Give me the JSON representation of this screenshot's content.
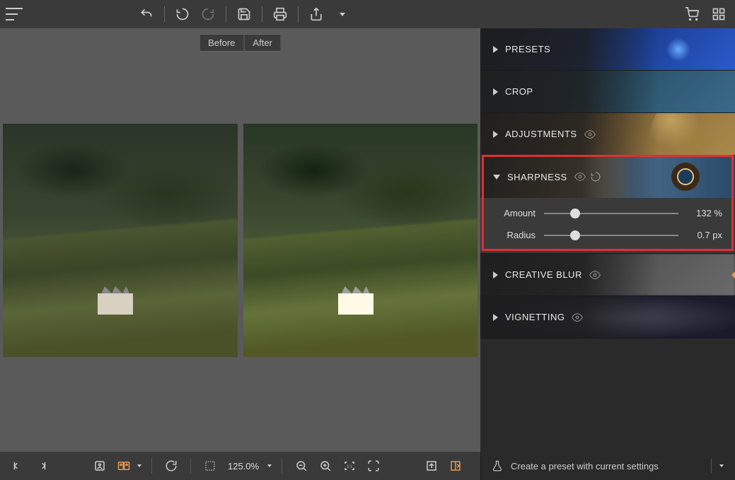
{
  "compare": {
    "before": "Before",
    "after": "After"
  },
  "panels": {
    "presets": {
      "title": "PRESETS"
    },
    "crop": {
      "title": "CROP"
    },
    "adjustments": {
      "title": "ADJUSTMENTS"
    },
    "sharpness": {
      "title": "SHARPNESS",
      "sliders": {
        "amount": {
          "label": "Amount",
          "value": "132 %",
          "pos": 23
        },
        "radius": {
          "label": "Radius",
          "value": "0.7 px",
          "pos": 23
        }
      }
    },
    "creativeblur": {
      "title": "CREATIVE BLUR"
    },
    "vignetting": {
      "title": "VIGNETTING"
    }
  },
  "bottombar": {
    "zoom": "125.0%",
    "preset_cta": "Create a preset with current settings"
  }
}
